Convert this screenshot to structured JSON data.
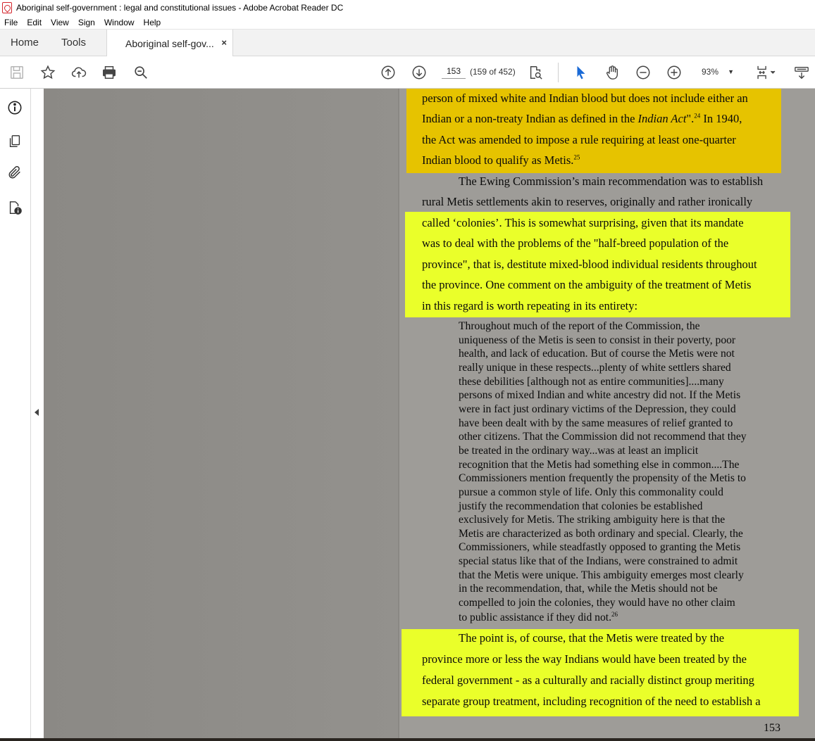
{
  "window": {
    "title": "Aboriginal self-government : legal and constitutional issues - Adobe Acrobat Reader DC"
  },
  "menu": [
    "File",
    "Edit",
    "View",
    "Sign",
    "Window",
    "Help"
  ],
  "tabs": {
    "home": "Home",
    "tools": "Tools",
    "document": "Aboriginal self-gov...",
    "close_symbol": "×"
  },
  "toolbar": {
    "icons": [
      "save-icon",
      "star-icon",
      "upload-icon",
      "print-icon",
      "search-icon",
      "prev-page-icon",
      "next-page-icon",
      "page-search-icon",
      "select-cursor-icon",
      "hand-icon",
      "zoom-out-icon",
      "zoom-in-icon",
      "fit-page-icon",
      "read-mode-icon"
    ],
    "page_number": "153",
    "page_count": "(159 of 452)",
    "zoom": "93%"
  },
  "left_rail": {
    "icons": [
      "info-icon",
      "pages-icon",
      "attachment-icon",
      "document-properties-icon"
    ]
  },
  "document": {
    "highlight_colors": {
      "orange": "#e6c300",
      "yellow": "#eaff2a"
    },
    "para1": [
      "person of mixed white and Indian blood but does not include either an",
      "Indian or a non-treaty Indian as defined in the ",
      "Indian Act",
      "\".",
      "24",
      " In 1940,",
      "the Act was amended to impose a rule requiring at least one-quarter",
      "Indian blood to qualify as Metis.",
      "25"
    ],
    "para2": [
      "The Ewing Commission’s main recommendation was to establish",
      "rural Metis settlements akin to reserves, originally and rather ironically",
      "called ‘colonies’. This is somewhat surprising, given that its mandate",
      "was to deal with the problems of the \"half-breed population of the",
      "province\", that is, destitute mixed-blood individual residents throughout",
      "the province. One comment on the ambiguity of the treatment of Metis",
      "in this regard is worth repeating in its entirety:"
    ],
    "quote": [
      "Throughout much of the report of the Commission, the",
      "uniqueness of the Metis is seen to consist in their poverty, poor",
      "health, and lack of education. But of course the Metis were not",
      "really unique in these respects...plenty of white settlers shared",
      "these debilities [although not as entire communities]....many",
      "persons of mixed Indian and white ancestry did not. If the Metis",
      "were in fact just ordinary victims of the Depression, they could",
      "have been dealt with by the same measures of relief granted to",
      "other citizens. That the Commission did not recommend that they",
      "be treated in the ordinary way...was at least an implicit",
      "recognition that the Metis had something else in common....The",
      "Commissioners mention frequently the propensity of the Metis to",
      "pursue a common style of life. Only this commonality could",
      "justify the recommendation that colonies be established",
      "exclusively for Metis. The striking ambiguity here is that the",
      "Metis are characterized as both ordinary and special. Clearly, the",
      "Commissioners, while steadfastly opposed to granting the Metis",
      "special status like that of the Indians, were constrained to admit",
      "that the Metis were unique. This ambiguity emerges most clearly",
      "in the recommendation, that, while the Metis should not be",
      "compelled to join the colonies, they would have no other claim",
      "to public assistance if they did not.",
      "26"
    ],
    "para3": [
      "The point is, of course, that the Metis were treated by the",
      "province more or less the way Indians would have been treated by the",
      "federal government - as a culturally and racially distinct group meriting",
      "separate group treatment, including recognition of the need to establish a"
    ],
    "page_number": "153"
  }
}
